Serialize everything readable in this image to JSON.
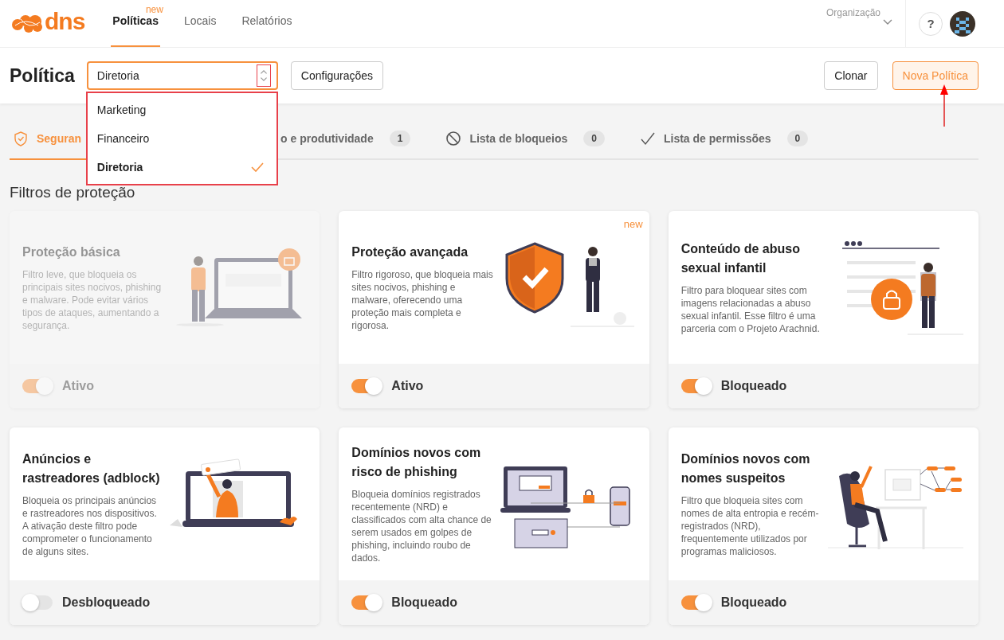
{
  "header": {
    "logo": "dns",
    "nav": [
      {
        "label": "Políticas",
        "selected": true,
        "badge": "new"
      },
      {
        "label": "Locais",
        "selected": false
      },
      {
        "label": "Relatórios",
        "selected": false
      }
    ],
    "organization_select": {
      "label": "Organização"
    },
    "help": "?"
  },
  "toolbar": {
    "title": "Política",
    "policy_select": {
      "value": "Diretoria",
      "expanded": true,
      "highlighted": true
    },
    "settings_button": "Configurações",
    "clone_button": "Clonar",
    "new_button": {
      "label": "Nova Política",
      "annotated": true
    }
  },
  "policy_menu": [
    {
      "label": "Marketing",
      "selected": false
    },
    {
      "label": "Financeiro",
      "selected": false
    },
    {
      "label": "Diretoria",
      "selected": true
    }
  ],
  "tabs": [
    {
      "label": "Seguran",
      "selected": true,
      "kind": "shield"
    },
    {
      "label": "o e produtividade",
      "selected": false,
      "count": "1",
      "kind": "plain"
    },
    {
      "label": "Lista de bloqueios",
      "selected": false,
      "count": "0",
      "kind": "block"
    },
    {
      "label": "Lista de permissões",
      "selected": false,
      "count": "0",
      "kind": "check"
    }
  ],
  "section_title": "Filtros de proteção",
  "cards": [
    {
      "title": "Proteção básica",
      "description": "Filtro leve, que bloqueia os principais sites nocivos, phishing e malware. Pode evitar vários tipos de ataques, aumentando a segurança.",
      "on": true,
      "disabled": true,
      "status": "Ativo",
      "kind": "laptop-woman"
    },
    {
      "title": "Proteção avançada",
      "description": "Filtro rigoroso, que bloqueia mais sites nocivos, phishing e malware, oferecendo uma proteção mais completa e rigorosa.",
      "on": true,
      "disabled": false,
      "status": "Ativo",
      "badge": "new",
      "kind": "shield-man"
    },
    {
      "title": "Conteúdo de abuso sexual infantil",
      "description": "Filtro para bloquear sites com imagens relacionadas a abuso sexual infantil. Esse filtro é uma parceria com o Projeto Arachnid.",
      "on": true,
      "disabled": false,
      "status": "Bloqueado",
      "kind": "lock-page"
    },
    {
      "title": "Anúncios e rastreadores (adblock)",
      "description": "Bloqueia os principais anúncios e rastreadores nos dispositivos. A ativação deste filtro pode comprometer o funcionamento de alguns sites.",
      "on": false,
      "disabled": false,
      "status": "Desbloqueado",
      "kind": "laptop-person"
    },
    {
      "title": "Domínios novos com risco de phishing",
      "description": "Bloqueia domínios registrados recentemente (NRD) e classificados com alta chance de serem usados em golpes de phishing, incluindo roubo de dados.",
      "on": true,
      "disabled": false,
      "status": "Bloqueado",
      "kind": "devices"
    },
    {
      "title": "Domínios novos com nomes suspeitos",
      "description": "Filtro que bloqueia sites com nomes de alta entropia e recém-registrados (NRD), frequentemente utilizados por programas maliciosos.",
      "on": true,
      "disabled": false,
      "status": "Bloqueado",
      "kind": "chair-network"
    }
  ]
}
